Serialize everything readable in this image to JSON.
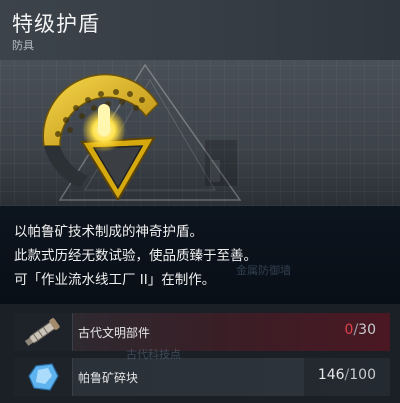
{
  "item": {
    "title": "特级护盾",
    "category": "防具",
    "description": [
      "以帕鲁矿技术制成的神奇护盾。",
      "此款式历经无数试验，使品质臻于至善。",
      "可「作业流水线工厂 II」在制作。"
    ],
    "icon": "shield-icon",
    "background_faint_labels": [
      "金属防御墙",
      "古代科技点"
    ]
  },
  "requirements": [
    {
      "name": "古代文明部件",
      "icon": "ancient-part-icon",
      "have": "0",
      "need": "30",
      "status": "insufficient",
      "status_color": "#e0424e"
    },
    {
      "name": "帕鲁矿碎块",
      "icon": "paldium-fragment-icon",
      "have": "146",
      "need": "100",
      "status": "sufficient",
      "status_color": "#e8e8e8"
    }
  ],
  "colors": {
    "header_bg": "#3a4149",
    "accent_gold": "#f2c418",
    "warn_red": "#e0424e"
  }
}
